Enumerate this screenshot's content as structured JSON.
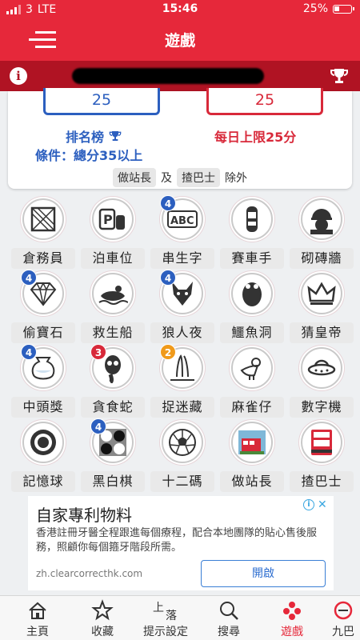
{
  "status": {
    "carrier": "3",
    "network": "LTE",
    "time": "15:46",
    "battery": "25%"
  },
  "nav": {
    "title": "遊戲"
  },
  "card": {
    "rank_value": "25",
    "daily_value": "25",
    "rank_label": "排名榜",
    "rank_condition": "條件：總分35以上",
    "daily_limit": "每日上限25分",
    "exclude_a": "做站長",
    "exclude_and": "及",
    "exclude_b": "揸巴士",
    "exclude_suffix": "除外"
  },
  "games": [
    {
      "label": "倉務員",
      "icon": "crate-icon",
      "badge": ""
    },
    {
      "label": "泊車位",
      "icon": "parking-icon",
      "badge": ""
    },
    {
      "label": "串生字",
      "icon": "abc-icon",
      "badge": "4"
    },
    {
      "label": "賽車手",
      "icon": "race-car-icon",
      "badge": ""
    },
    {
      "label": "砌磚牆",
      "icon": "builder-icon",
      "badge": ""
    },
    {
      "label": "偷寶石",
      "icon": "diamond-icon",
      "badge": "4"
    },
    {
      "label": "救生船",
      "icon": "lifeboat-icon",
      "badge": ""
    },
    {
      "label": "狼人夜",
      "icon": "wolf-icon",
      "badge": "4"
    },
    {
      "label": "鱷魚洞",
      "icon": "crocodile-icon",
      "badge": ""
    },
    {
      "label": "猜皇帝",
      "icon": "crown-icon",
      "badge": ""
    },
    {
      "label": "中頭獎",
      "icon": "lottery-icon",
      "badge": "4"
    },
    {
      "label": "貪食蛇",
      "icon": "snake-icon",
      "badge": "3"
    },
    {
      "label": "捉迷藏",
      "icon": "rabbit-icon",
      "badge": "2"
    },
    {
      "label": "麻雀仔",
      "icon": "bird-icon",
      "badge": ""
    },
    {
      "label": "數字機",
      "icon": "ufo-icon",
      "badge": ""
    },
    {
      "label": "記憶球",
      "icon": "target-icon",
      "badge": ""
    },
    {
      "label": "黑白棋",
      "icon": "othello-icon",
      "badge": "4"
    },
    {
      "label": "十二碼",
      "icon": "football-icon",
      "badge": ""
    },
    {
      "label": "做站長",
      "icon": "bus-stop-icon",
      "badge": ""
    },
    {
      "label": "揸巴士",
      "icon": "bus-icon",
      "badge": ""
    }
  ],
  "badge_colors": {
    "4": "#2c5fbf",
    "3": "#d8293a",
    "2": "#f09a1a"
  },
  "ad": {
    "title": "自家專利物料",
    "body": "香港註冊牙醫全程跟進每個療程，配合本地團隊的貼心售後服務，照顧你每個箍牙階段所需。",
    "url": "zh.clearcorrecthk.com",
    "button": "開啟"
  },
  "tabs": [
    {
      "label": "主頁",
      "icon": "home-icon"
    },
    {
      "label": "收藏",
      "icon": "star-icon"
    },
    {
      "label": "提示設定",
      "icon": "hint-settings-icon",
      "glyph_top": "上",
      "glyph_bottom": "落"
    },
    {
      "label": "搜尋",
      "icon": "search-icon"
    },
    {
      "label": "遊戲",
      "icon": "games-icon",
      "active": true
    },
    {
      "label": "九巴",
      "icon": "kmb-icon"
    }
  ],
  "colors": {
    "primary": "#e6283a",
    "dark_red": "#b01323",
    "blue": "#2c5fbf"
  }
}
